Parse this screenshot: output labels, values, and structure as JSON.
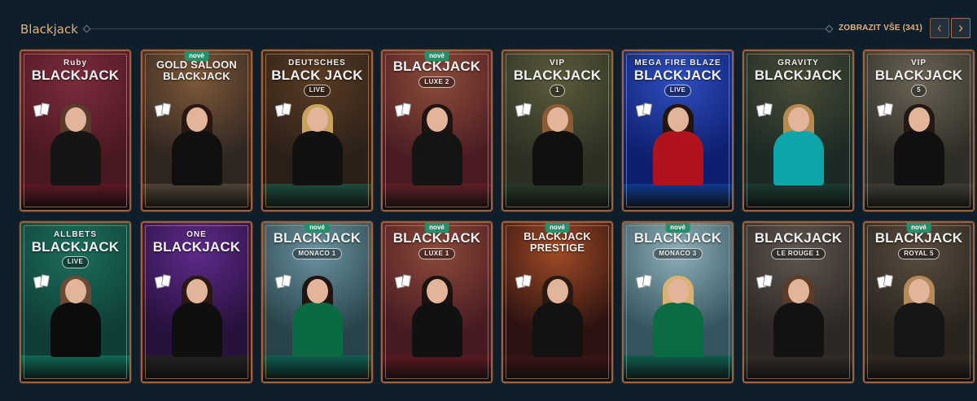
{
  "header": {
    "title": "Blackjack",
    "show_all": "ZOBRAZIT VŠE (341)",
    "prev_icon": "chevron-left-icon",
    "next_icon": "chevron-right-icon"
  },
  "badge_label": "nové",
  "games": [
    {
      "name": "Ruby Blackjack",
      "small": "Ruby",
      "main": "BLACKJACK",
      "sub": "",
      "badge": false,
      "bg": "#4a1820",
      "accent": "#7b2b3c",
      "table": "#5c1822",
      "hair": "#5a3a2a",
      "body": "#151515"
    },
    {
      "name": "Gold Saloon Blackjack",
      "small": "",
      "main": "GOLD SALOON BLACKJACK",
      "sub": "",
      "badge": true,
      "bg": "#2f2521",
      "accent": "#7d5838",
      "table": "#4e4336",
      "hair": "#2a1712",
      "body": "#101010"
    },
    {
      "name": "Deutsches Black Jack Live",
      "small": "DEUTSCHES",
      "main": "BLACK JACK",
      "sub": "LIVE",
      "badge": false,
      "bg": "#2a2018",
      "accent": "#5a3b24",
      "table": "#1f4b3d",
      "hair": "#c9a25b",
      "body": "#111111"
    },
    {
      "name": "Blackjack Luxe 2",
      "small": "",
      "main": "BLACKJACK",
      "sub": "LUXE 2",
      "badge": true,
      "bg": "#4a1c22",
      "accent": "#8c4c3a",
      "table": "#5f2026",
      "hair": "#1f1412",
      "body": "#141414"
    },
    {
      "name": "VIP Blackjack 1",
      "small": "VIP",
      "main": "BLACKJACK",
      "sub": "1",
      "badge": false,
      "bg": "#2c3023",
      "accent": "#5b5a3c",
      "table": "#283828",
      "hair": "#8a5c34",
      "body": "#101010"
    },
    {
      "name": "Mega Fire Blaze Blackjack Live",
      "small": "MEGA FIRE BLAZE",
      "main": "BLACKJACK",
      "sub": "LIVE",
      "badge": false,
      "bg": "#0d1f6d",
      "accent": "#2f4fc2",
      "table": "#0e3a8e",
      "hair": "#24160f",
      "body": "#b0131e"
    },
    {
      "name": "Gravity Blackjack",
      "small": "GRAVITY",
      "main": "BLACKJACK",
      "sub": "",
      "badge": false,
      "bg": "#1b2a24",
      "accent": "#4a4c37",
      "table": "#1c3a31",
      "hair": "#b58a52",
      "body": "#0ca5aa"
    },
    {
      "name": "VIP Blackjack 5",
      "small": "VIP",
      "main": "BLACKJACK",
      "sub": "5",
      "badge": false,
      "bg": "#2f2d27",
      "accent": "#6a6454",
      "table": "#3e3c35",
      "hair": "#251714",
      "body": "#101010"
    },
    {
      "name": "All Bets Blackjack Live",
      "small": "ALLBETS",
      "main": "BLACKJACK",
      "sub": "LIVE",
      "badge": false,
      "bg": "#0f3e36",
      "accent": "#1c6e5e",
      "table": "#0e6a54",
      "hair": "#6a4a34",
      "body": "#0c0c0c"
    },
    {
      "name": "One Blackjack",
      "small": "ONE",
      "main": "BLACKJACK",
      "sub": "",
      "badge": false,
      "bg": "#27113d",
      "accent": "#5e2a8b",
      "table": "#222222",
      "hair": "#2a1814",
      "body": "#0f0f0f"
    },
    {
      "name": "Blackjack Monaco 1",
      "small": "",
      "main": "BLACKJACK",
      "sub": "MONACO 1",
      "badge": true,
      "bg": "#28434a",
      "accent": "#6a93a0",
      "table": "#0f5f52",
      "hair": "#201410",
      "body": "#0b6a42"
    },
    {
      "name": "Blackjack Luxe 1",
      "small": "",
      "main": "BLACKJACK",
      "sub": "LUXE 1",
      "badge": true,
      "bg": "#471b21",
      "accent": "#8d4a3b",
      "table": "#5a1a22",
      "hair": "#1d130f",
      "body": "#111111"
    },
    {
      "name": "Blackjack Prestige",
      "small": "",
      "main": "BLACKJACK PRESTIGE",
      "sub": "",
      "badge": true,
      "bg": "#2c1210",
      "accent": "#a04a26",
      "table": "#3a1514",
      "hair": "#2a1a14",
      "body": "#121212"
    },
    {
      "name": "Blackjack Monaco 3",
      "small": "",
      "main": "BLACKJACK",
      "sub": "MONACO 3",
      "badge": true,
      "bg": "#35545d",
      "accent": "#8fb0ba",
      "table": "#0f5d50",
      "hair": "#d9b172",
      "body": "#0b6c44"
    },
    {
      "name": "Blackjack Le Rouge 1",
      "small": "",
      "main": "BLACKJACK",
      "sub": "LE ROUGE 1",
      "badge": false,
      "bg": "#2d2825",
      "accent": "#5f5650",
      "table": "#332d28",
      "hair": "#5c3b27",
      "body": "#121212"
    },
    {
      "name": "Blackjack Royal 5",
      "small": "",
      "main": "BLACKJACK",
      "sub": "ROYAL 5",
      "badge": true,
      "bg": "#29241e",
      "accent": "#5a4d3f",
      "table": "#322a23",
      "hair": "#b48a5a",
      "body": "#161616"
    }
  ]
}
